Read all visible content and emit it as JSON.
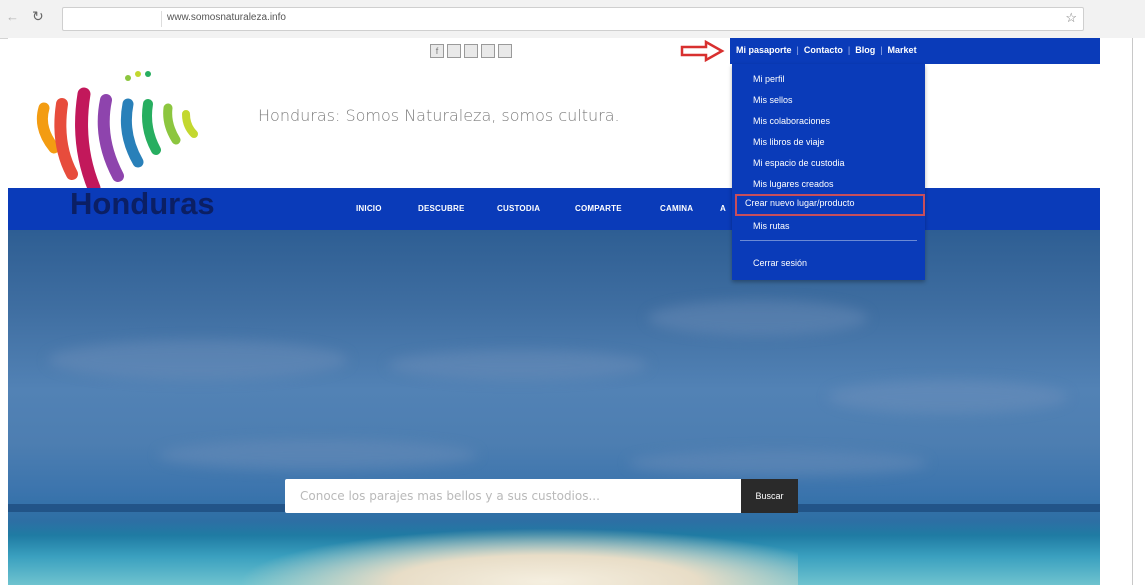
{
  "browser": {
    "url": "www.somosnaturaleza.info",
    "back_icon": "back-arrow-icon",
    "reload_icon": "reload-icon",
    "bookmark_icon": "star-icon"
  },
  "colors": {
    "brand_blue": "#0a3bb9",
    "highlight_border": "#c84e5b",
    "logo_text": "#0b1f64"
  },
  "top_bar": {
    "links": [
      "Mi pasaporte",
      "Contacto",
      "Blog",
      "Market"
    ],
    "social_icons": [
      "facebook-icon",
      "twitter-icon",
      "instagram-icon",
      "youtube-icon",
      "pinterest-icon"
    ]
  },
  "header": {
    "logo_text": "Honduras",
    "tagline": "Honduras: Somos Naturaleza, somos cultura."
  },
  "main_nav": {
    "items": [
      "INICIO",
      "DESCUBRE",
      "CUSTODIA",
      "COMPARTE",
      "CAMINA",
      "A"
    ]
  },
  "dropdown": {
    "items": [
      "Mi perfil",
      "Mis sellos",
      "Mis colaboraciones",
      "Mis libros de viaje",
      "Mi espacio de custodia",
      "Mis lugares creados",
      "Crear nuevo lugar/producto",
      "Mis rutas"
    ],
    "logout": "Cerrar sesión",
    "highlighted_item": "Crear nuevo lugar/producto"
  },
  "search": {
    "placeholder": "Conoce los parajes mas bellos y a sus custodios...",
    "button_label": "Buscar"
  }
}
